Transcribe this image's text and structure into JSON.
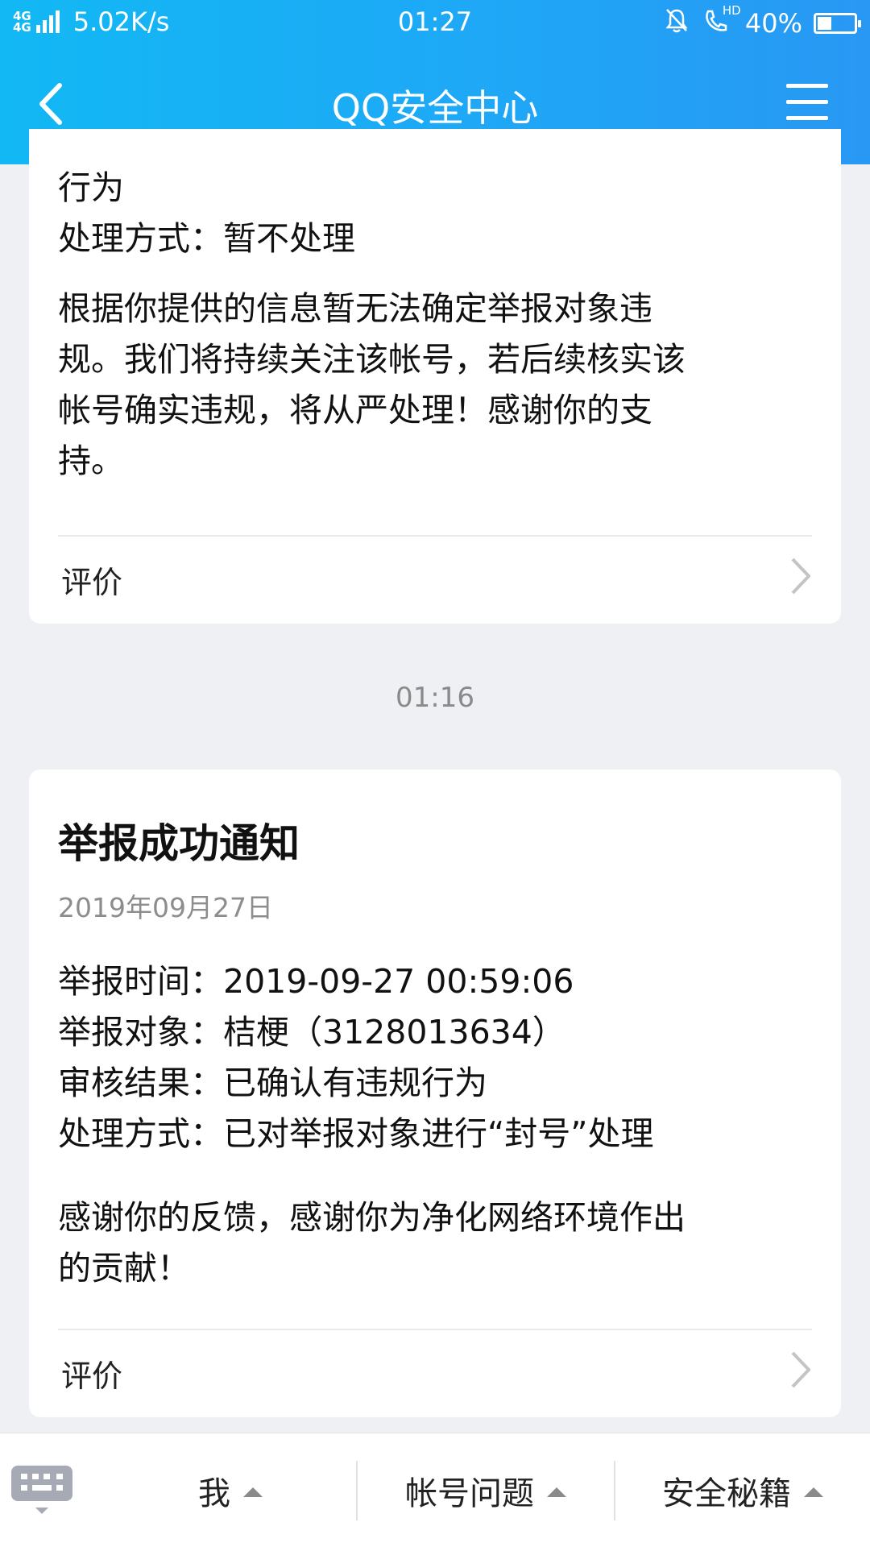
{
  "status_bar": {
    "network": "4G 4G",
    "speed": "5.02K/s",
    "time": "01:27",
    "icons": [
      "signal-icon",
      "mute-bell-icon",
      "hd-call-icon",
      "battery-icon"
    ],
    "hd_label": "HD",
    "battery": "40%"
  },
  "header": {
    "title": "QQ安全中心",
    "back_icon": "chevron-left-icon",
    "menu_icon": "hamburger-menu-icon",
    "gradient": [
      "#12b8f4",
      "#2898f4"
    ]
  },
  "card1": {
    "lines": [
      "行为",
      "处理方式：暂不处理"
    ],
    "message_lines": [
      "根据你提供的信息暂无法确定举报对象违",
      "规。我们将持续关注该帐号，若后续核实该",
      "帐号确实违规，将从严处理！感谢你的支",
      "持。"
    ],
    "rate_label": "评价"
  },
  "timestamp": "01:16",
  "card2": {
    "title": "举报成功通知",
    "date": "2019年09月27日",
    "fields": [
      "举报时间：2019-09-27 00:59:06",
      "举报对象：桔梗（3128013634）",
      "审核结果：已确认有违规行为",
      "处理方式：已对举报对象进行“封号”处理"
    ],
    "message_lines": [
      "感谢你的反馈，感谢你为净化网络环境作出",
      "的贡献！"
    ],
    "rate_label": "评价"
  },
  "bottom_bar": {
    "keyboard_icon": "keyboard-icon",
    "tabs": [
      {
        "label": "我"
      },
      {
        "label": "帐号问题"
      },
      {
        "label": "安全秘籍"
      }
    ]
  }
}
